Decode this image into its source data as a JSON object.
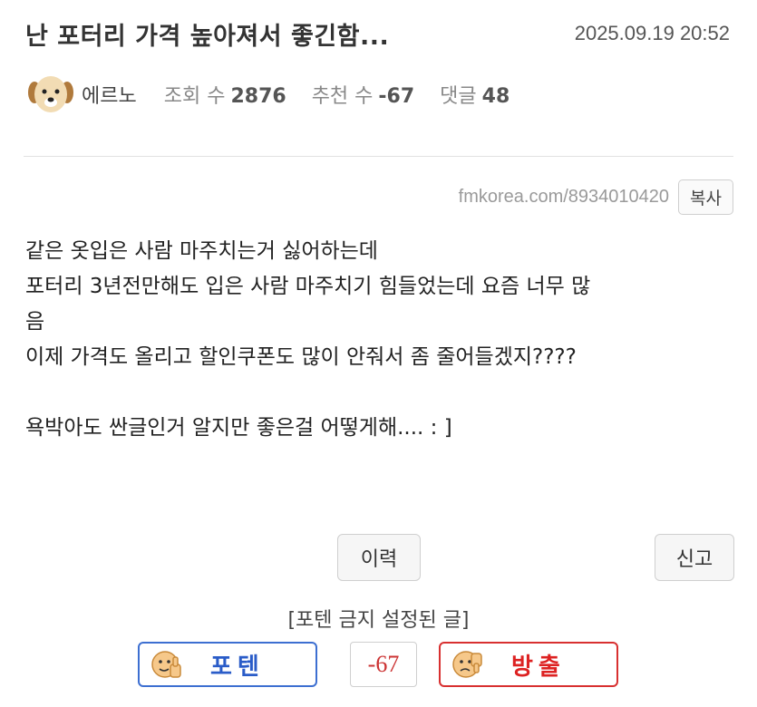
{
  "post": {
    "title": "난 포터리 가격 높아져서 좋긴함...",
    "date": "2025.09.19 20:52",
    "author": "에르노",
    "views_label": "조회 수",
    "views": "2876",
    "recommend_label": "추천 수",
    "recommend": "-67",
    "comments_label": "댓글",
    "comments": "48",
    "url": "fmkorea.com/8934010420",
    "copy_label": "복사",
    "body": [
      "같은 옷입은 사람 마주치는거 싫어하는데",
      "포터리 3년전만해도 입은 사람 마주치기 힘들었는데 요즘 너무 많",
      "음",
      "이제 가격도 올리고 할인쿠폰도 많이 안줘서 좀 줄어들겠지????",
      "",
      "욕박아도 싼글인거 알지만 좋은걸 어떻게해....  : ]"
    ]
  },
  "actions": {
    "history_label": "이력",
    "report_label": "신고",
    "notice": "[포텐 금지 설정된 글]",
    "upvote_label": "포텐",
    "score": "-67",
    "downvote_label": "방출"
  },
  "colors": {
    "upvote": "#3d6fd1",
    "downvote": "#d83030",
    "score": "#cc3333"
  },
  "icons": {
    "avatar": "puppy-avatar-icon",
    "upvote": "thumbs-up-face-icon",
    "downvote": "thumbs-down-face-icon"
  }
}
